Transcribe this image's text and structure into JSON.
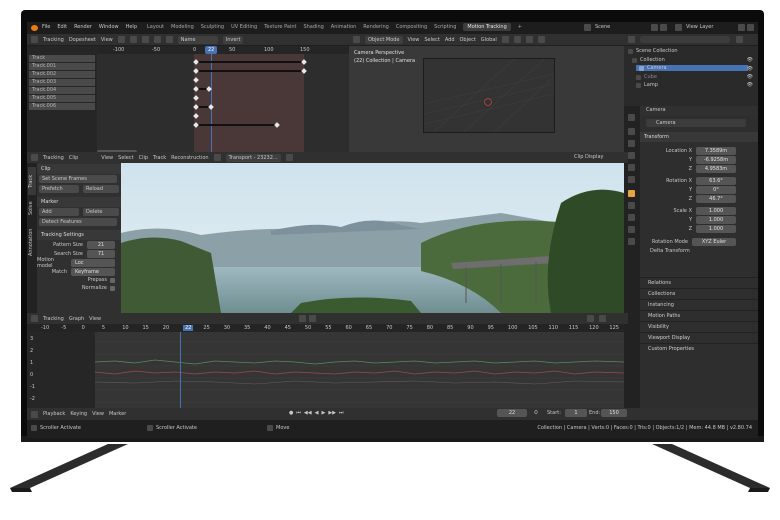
{
  "app": {
    "file_menu": [
      "File",
      "Edit",
      "Render",
      "Window",
      "Help"
    ],
    "workspace_tabs": [
      "Layout",
      "Modeling",
      "Sculpting",
      "UV Editing",
      "Texture Paint",
      "Shading",
      "Animation",
      "Rendering",
      "Compositing",
      "Scripting",
      "Motion Tracking"
    ],
    "active_tab": "Motion Tracking",
    "scene_name": "Scene",
    "view_layer": "View Layer"
  },
  "dopesheet": {
    "mode": "Tracking",
    "editor": "Dopesheet",
    "view_menu": "View",
    "sort": "Name",
    "invert": "Invert",
    "ruler": [
      "-100",
      "-50",
      "0",
      "22",
      "50",
      "100",
      "150"
    ],
    "tracks": [
      "Track",
      "Track.001",
      "Track.002",
      "Track.003",
      "Track.004",
      "Track.005",
      "Track.006"
    ]
  },
  "viewport3d": {
    "mode": "Object Mode",
    "menus": [
      "View",
      "Select",
      "Add",
      "Object"
    ],
    "orientation": "Global",
    "perspective": "Camera Perspective",
    "collection_label": "(22) Collection | Camera"
  },
  "outliner": {
    "items": [
      {
        "label": "Scene Collection"
      },
      {
        "label": "Collection"
      },
      {
        "label": "Camera"
      },
      {
        "label": "Cube"
      },
      {
        "label": "Lamp"
      }
    ]
  },
  "properties": {
    "object_title": "Camera",
    "object_name": "Camera",
    "transform_header": "Transform",
    "location": {
      "label": "Location X",
      "x": "7.3589m",
      "y": "-6.9258m",
      "z": "4.9583m"
    },
    "rotation": {
      "label": "Rotation X",
      "x": "63.6°",
      "y": "0°",
      "z": "46.7°"
    },
    "scale": {
      "label": "Scale X",
      "x": "1.000",
      "y": "1.000",
      "z": "1.000"
    },
    "rotation_mode_label": "Rotation Mode",
    "rotation_mode": "XYZ Euler",
    "delta_transform": "Delta Transform",
    "sections": [
      "Relations",
      "Collections",
      "Instancing",
      "Motion Paths",
      "Visibility",
      "Viewport Display",
      "Custom Properties"
    ]
  },
  "clip_editor": {
    "mode": "Tracking",
    "clip_menu": "Clip",
    "menus": [
      "View",
      "Select",
      "Clip",
      "Track",
      "Reconstruction"
    ],
    "clip_name": "Transport - 23232...",
    "display": "Clip Display",
    "side_tabs": [
      "Track",
      "Solve",
      "Annotation"
    ],
    "clip_section": "Clip",
    "set_scene_frames": "Set Scene Frames",
    "prefetch": "Prefetch",
    "reload": "Reload",
    "marker_section": "Marker",
    "add": "Add",
    "delete": "Delete",
    "detect_features": "Detect Features",
    "tracking_settings": "Tracking Settings",
    "pattern_size_label": "Pattern Size",
    "pattern_size": "21",
    "search_size_label": "Search Size",
    "search_size": "71",
    "motion_model_label": "Motion model",
    "motion_model": "Loc",
    "match_label": "Match",
    "match": "Keyframe",
    "prepass": "Prepass",
    "normalize": "Normalize"
  },
  "graph": {
    "mode": "Tracking",
    "editor": "Graph",
    "view_menu": "View",
    "ruler": [
      "-10",
      "-5",
      "0",
      "5",
      "10",
      "15",
      "20",
      "22",
      "25",
      "30",
      "35",
      "40",
      "45",
      "50",
      "55",
      "60",
      "65",
      "70",
      "75",
      "80",
      "85",
      "90",
      "95",
      "100",
      "105",
      "110",
      "115",
      "120",
      "125"
    ],
    "y_labels": [
      "3",
      "2",
      "1",
      "0",
      "-1",
      "-2"
    ]
  },
  "timeline": {
    "menus": [
      "Playback",
      "Keying",
      "View",
      "Marker"
    ],
    "current_frame": "22",
    "start_label": "Start:",
    "start": "1",
    "end_label": "End:",
    "end": "150"
  },
  "statusbar": {
    "hints": [
      "Scroller Activate",
      "Scroller Activate",
      "Move"
    ],
    "stats": "Collection | Camera | Verts:0 | Faces:0 | Tris:0 | Objects:1/2 | Mem: 44.8 MB | v2.80.74"
  },
  "colors": {
    "accent": "#4772b3",
    "background": "#2b2b2b",
    "header": "#303030",
    "topbar": "#1d1d1d"
  }
}
